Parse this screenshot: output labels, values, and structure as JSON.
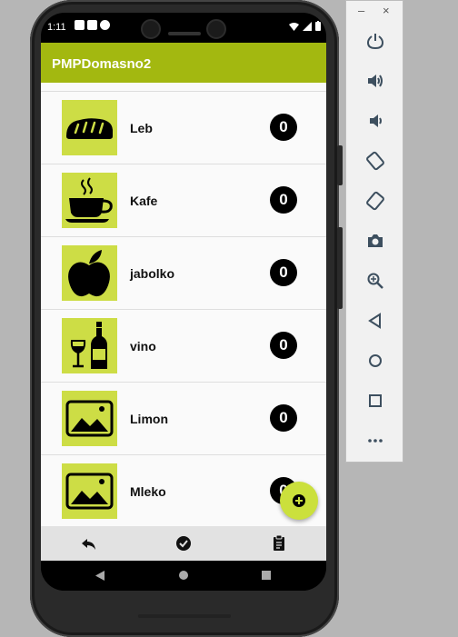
{
  "statusbar": {
    "time": "1:11"
  },
  "appbar": {
    "title": "PMPDomasno2"
  },
  "items": [
    {
      "name": "Leb",
      "count": "0",
      "image": "bread-icon"
    },
    {
      "name": "Kafe",
      "count": "0",
      "image": "coffee-cup-icon"
    },
    {
      "name": "jabolko",
      "count": "0",
      "image": "apple-icon"
    },
    {
      "name": "vino",
      "count": "0",
      "image": "wine-icon"
    },
    {
      "name": "Limon",
      "count": "0",
      "image": "image-placeholder-icon"
    },
    {
      "name": "Mleko",
      "count": "0",
      "image": "image-placeholder-icon"
    }
  ],
  "fab": {
    "icon": "add-circle-icon"
  },
  "bottombar": {
    "buttons": [
      "reply-icon",
      "check-circle-icon",
      "clipboard-icon"
    ]
  },
  "emulator_toolbar": {
    "window_controls": {
      "minimize": "–",
      "close": "×"
    },
    "buttons": [
      "power-icon",
      "volume-up-icon",
      "volume-down-icon",
      "rotate-left-icon",
      "rotate-right-icon",
      "camera-icon",
      "zoom-icon",
      "back-icon",
      "home-icon",
      "overview-icon",
      "more-icon"
    ]
  },
  "colors": {
    "appbar": "#a3b810",
    "thumb": "#cddd45",
    "fab": "#cbe03c"
  }
}
